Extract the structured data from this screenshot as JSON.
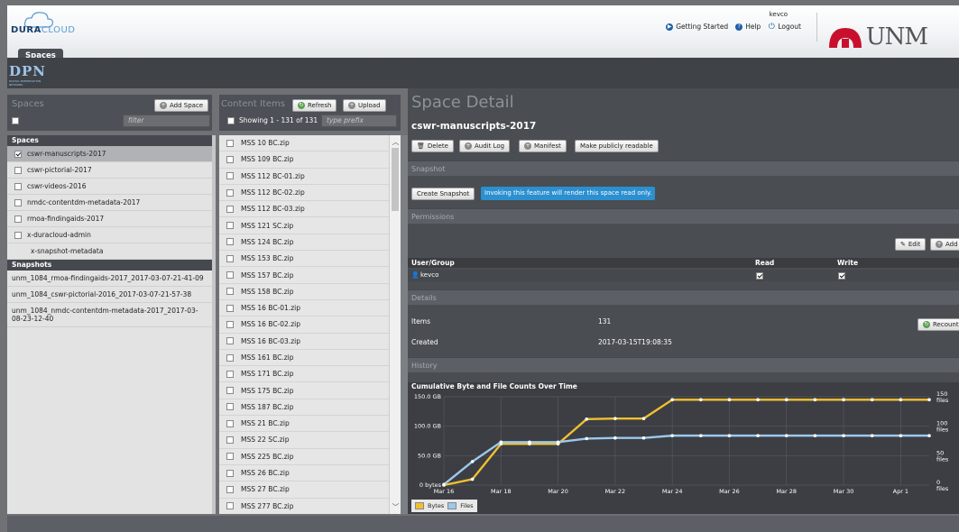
{
  "brand": {
    "logo_main": "DURA",
    "logo_accent": "CLOUD",
    "dpn_logo": "DPN",
    "dpn_tagline": "DIGITAL PRESERVATION NETWORK",
    "unm_logo": "UNM"
  },
  "nav": {
    "active_tab": "Spaces",
    "username": "kevco",
    "getting_started": "Getting Started",
    "help": "Help",
    "logout": "Logout"
  },
  "spaces_col": {
    "title": "Spaces",
    "add_button": "Add Space",
    "filter_placeholder": "filter"
  },
  "spaces": {
    "header": "Spaces",
    "items": [
      {
        "label": "cswr-manuscripts-2017",
        "checked": true,
        "selected": true
      },
      {
        "label": "cswr-pictorial-2017",
        "checked": false
      },
      {
        "label": "cswr-videos-2016",
        "checked": false
      },
      {
        "label": "nmdc-contentdm-metadata-2017",
        "checked": false
      },
      {
        "label": "rmoa-findingaids-2017",
        "checked": false
      },
      {
        "label": "x-duracloud-admin",
        "checked": false
      },
      {
        "label": "x-snapshot-metadata",
        "checked": null
      }
    ]
  },
  "snapshots": {
    "header": "Snapshots",
    "items": [
      "unm_1084_rmoa-findingaids-2017_2017-03-07-21-41-09",
      "unm_1084_cswr-pictorial-2016_2017-03-07-21-57-38",
      "unm_1084_nmdc-contentdm-metadata-2017_2017-03-08-23-12-40"
    ]
  },
  "content_col": {
    "title": "Content Items",
    "refresh": "Refresh",
    "upload": "Upload",
    "showing": "Showing 1 - 131 of 131",
    "prefix_placeholder": "type prefix"
  },
  "content_items": [
    "MSS 10 BC.zip",
    "MSS 109 BC.zip",
    "MSS 112 BC-01.zip",
    "MSS 112 BC-02.zip",
    "MSS 112 BC-03.zip",
    "MSS 121 SC.zip",
    "MSS 124 BC.zip",
    "MSS 153 BC.zip",
    "MSS 157 BC.zip",
    "MSS 158 BC.zip",
    "MSS 16 BC-01.zip",
    "MSS 16 BC-02.zip",
    "MSS 16 BC-03.zip",
    "MSS 161 BC.zip",
    "MSS 171 BC.zip",
    "MSS 175 BC.zip",
    "MSS 187 BC.zip",
    "MSS 21 BC.zip",
    "MSS 22 SC.zip",
    "MSS 225 BC.zip",
    "MSS 26 BC.zip",
    "MSS 27 BC.zip",
    "MSS 277 BC.zip"
  ],
  "detail": {
    "title": "Space Detail",
    "space_name": "cswr-manuscripts-2017",
    "buttons": {
      "delete": "Delete",
      "audit": "Audit Log",
      "manifest": "Manifest",
      "public": "Make publicly readable"
    },
    "snapshot": {
      "label": "Snapshot",
      "button": "Create Snapshot",
      "notice": "Invoking this feature will render this space read only."
    },
    "permissions": {
      "label": "Permissions",
      "edit": "Edit",
      "add": "Add",
      "col_user": "User/Group",
      "col_read": "Read",
      "col_write": "Write",
      "user": "kevco",
      "read": true,
      "write": true
    },
    "details": {
      "label": "Details",
      "items_label": "Items",
      "items_value": "131",
      "recount": "Recount",
      "created_label": "Created",
      "created_value": "2017-03-15T19:08:35"
    },
    "history": {
      "label": "History"
    }
  },
  "chart_data": {
    "type": "line",
    "title": "Cumulative Byte and File Counts Over Time",
    "x": [
      "Mar 16",
      "Mar 17",
      "Mar 18",
      "Mar 19",
      "Mar 20",
      "Mar 21",
      "Mar 22",
      "Mar 23",
      "Mar 24",
      "Mar 25",
      "Mar 26",
      "Mar 27",
      "Mar 28",
      "Mar 29",
      "Mar 30",
      "Mar 31",
      "Apr 1",
      "Apr 2"
    ],
    "xticks": [
      "Mar 16",
      "Mar 18",
      "Mar 20",
      "Mar 22",
      "Mar 24",
      "Mar 26",
      "Mar 28",
      "Mar 30",
      "Apr 1"
    ],
    "series": [
      {
        "name": "Bytes",
        "unit": "GB",
        "axis": "left",
        "color": "#f0c030",
        "values": [
          0,
          10,
          70,
          70,
          70,
          112,
          113,
          113,
          145,
          145,
          145,
          145,
          145,
          145,
          145,
          145,
          145,
          145
        ]
      },
      {
        "name": "Files",
        "unit": "files",
        "axis": "right",
        "color": "#9cc8ec",
        "values": [
          1,
          40,
          73,
          73,
          73,
          79,
          80,
          80,
          84,
          84,
          84,
          84,
          84,
          84,
          84,
          84,
          84,
          84
        ]
      }
    ],
    "ylim_left": [
      0,
      150
    ],
    "yticks_left": [
      "0 bytes",
      "50.0 GB",
      "100.0 GB",
      "150.0 GB"
    ],
    "ylim_right": [
      0,
      150
    ],
    "yticks_right": [
      "0 files",
      "50 files",
      "100 files",
      "150 files"
    ],
    "grid": true,
    "legend": "bottom-left"
  }
}
